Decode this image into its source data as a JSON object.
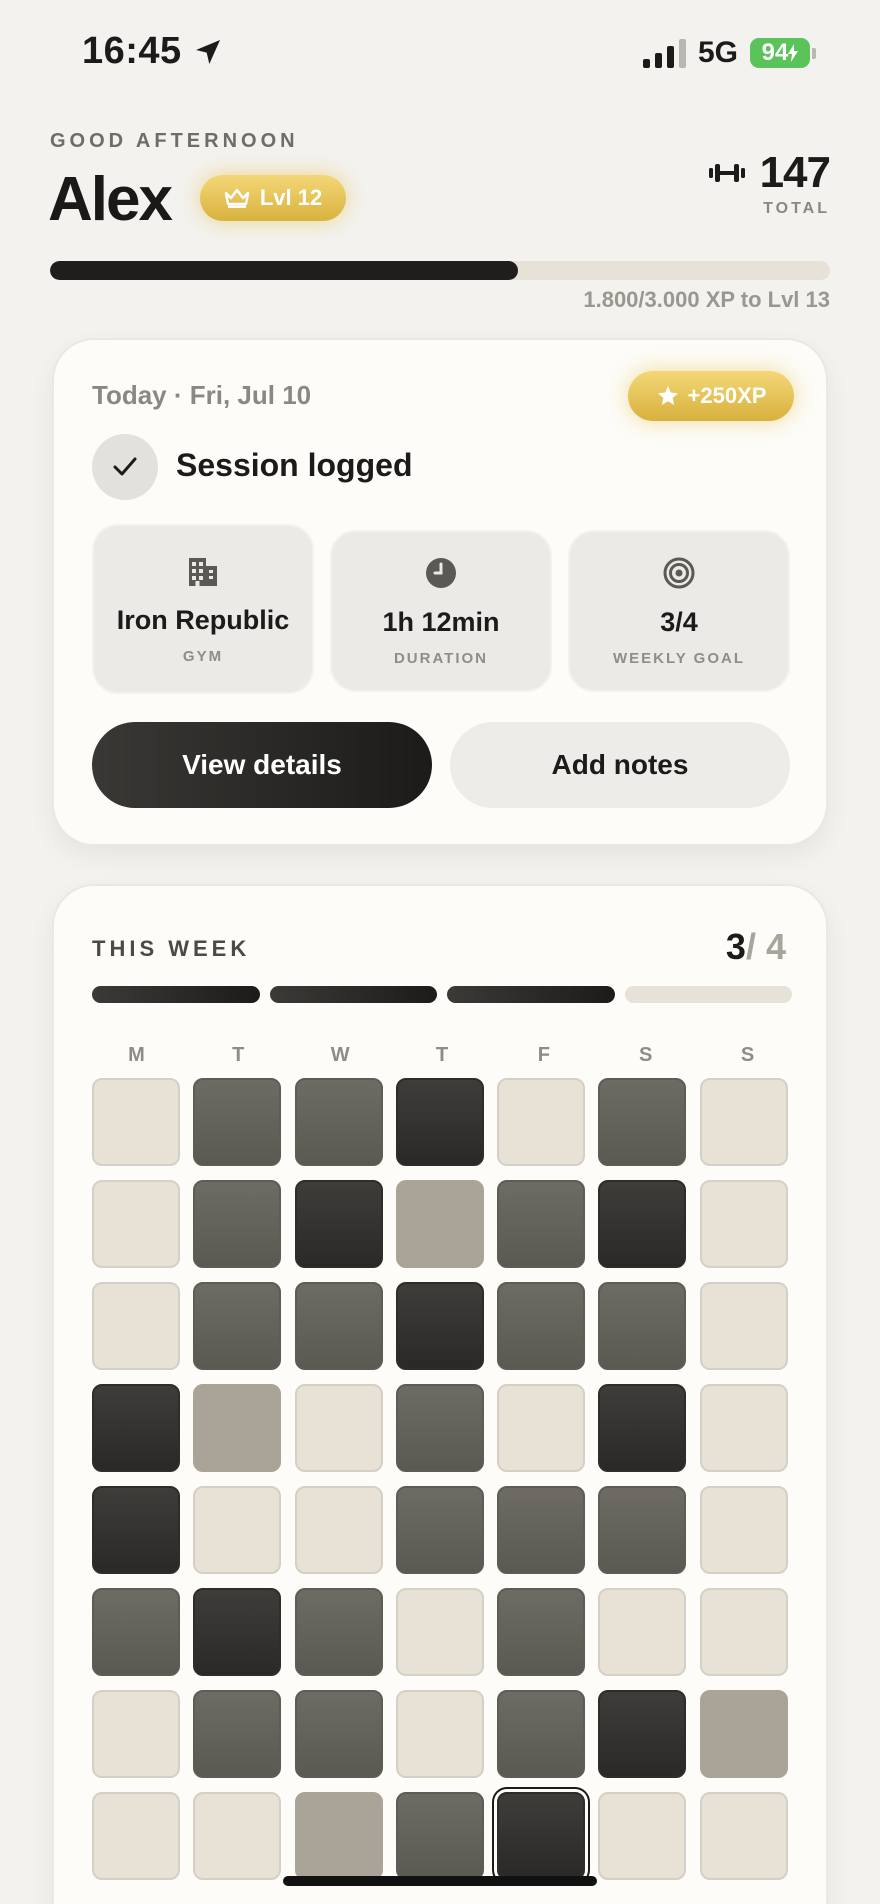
{
  "status_bar": {
    "time": "16:45",
    "network": "5G",
    "battery": "94"
  },
  "header": {
    "greeting": "GOOD AFTERNOON",
    "name": "Alex",
    "level": "Lvl 12",
    "total_value": "147",
    "total_label": "TOTAL",
    "xp_progress": 0.6,
    "xp_text": "1.800/3.000 XP to Lvl 13"
  },
  "today": {
    "date": "Today · Fri, Jul 10",
    "xp_award": "+250XP",
    "session_status": "Session logged",
    "stats": [
      {
        "value": "Iron Republic",
        "label": "GYM",
        "icon": "building-icon"
      },
      {
        "value": "1h 12min",
        "label": "DURATION",
        "icon": "clock-icon"
      },
      {
        "value": "3/4",
        "label": "WEEKLY GOAL",
        "icon": "target-icon"
      }
    ],
    "primary_action": "View details",
    "secondary_action": "Add notes"
  },
  "week": {
    "title": "THIS WEEK",
    "done": "3",
    "separator": "/",
    "goal": "4",
    "segments_done": 3,
    "segments_total": 4,
    "day_labels": [
      "M",
      "T",
      "W",
      "T",
      "F",
      "S",
      "S"
    ],
    "heatmap": [
      [
        0,
        2,
        2,
        3,
        0,
        2,
        0
      ],
      [
        0,
        2,
        3,
        1,
        2,
        3,
        0
      ],
      [
        0,
        2,
        2,
        3,
        2,
        2,
        0
      ],
      [
        3,
        1,
        0,
        2,
        0,
        3,
        0
      ],
      [
        3,
        0,
        0,
        2,
        2,
        2,
        0
      ],
      [
        2,
        3,
        2,
        0,
        2,
        0,
        0
      ],
      [
        0,
        2,
        2,
        0,
        2,
        3,
        1
      ],
      [
        0,
        0,
        1,
        2,
        3,
        0,
        0
      ]
    ],
    "today_cell": {
      "row": 7,
      "col": 4
    }
  },
  "colors": {
    "accent_gold": "#e0bb4a",
    "dark": "#1c1b19",
    "background": "#f3f2ef",
    "battery_green": "#5ac35a"
  }
}
